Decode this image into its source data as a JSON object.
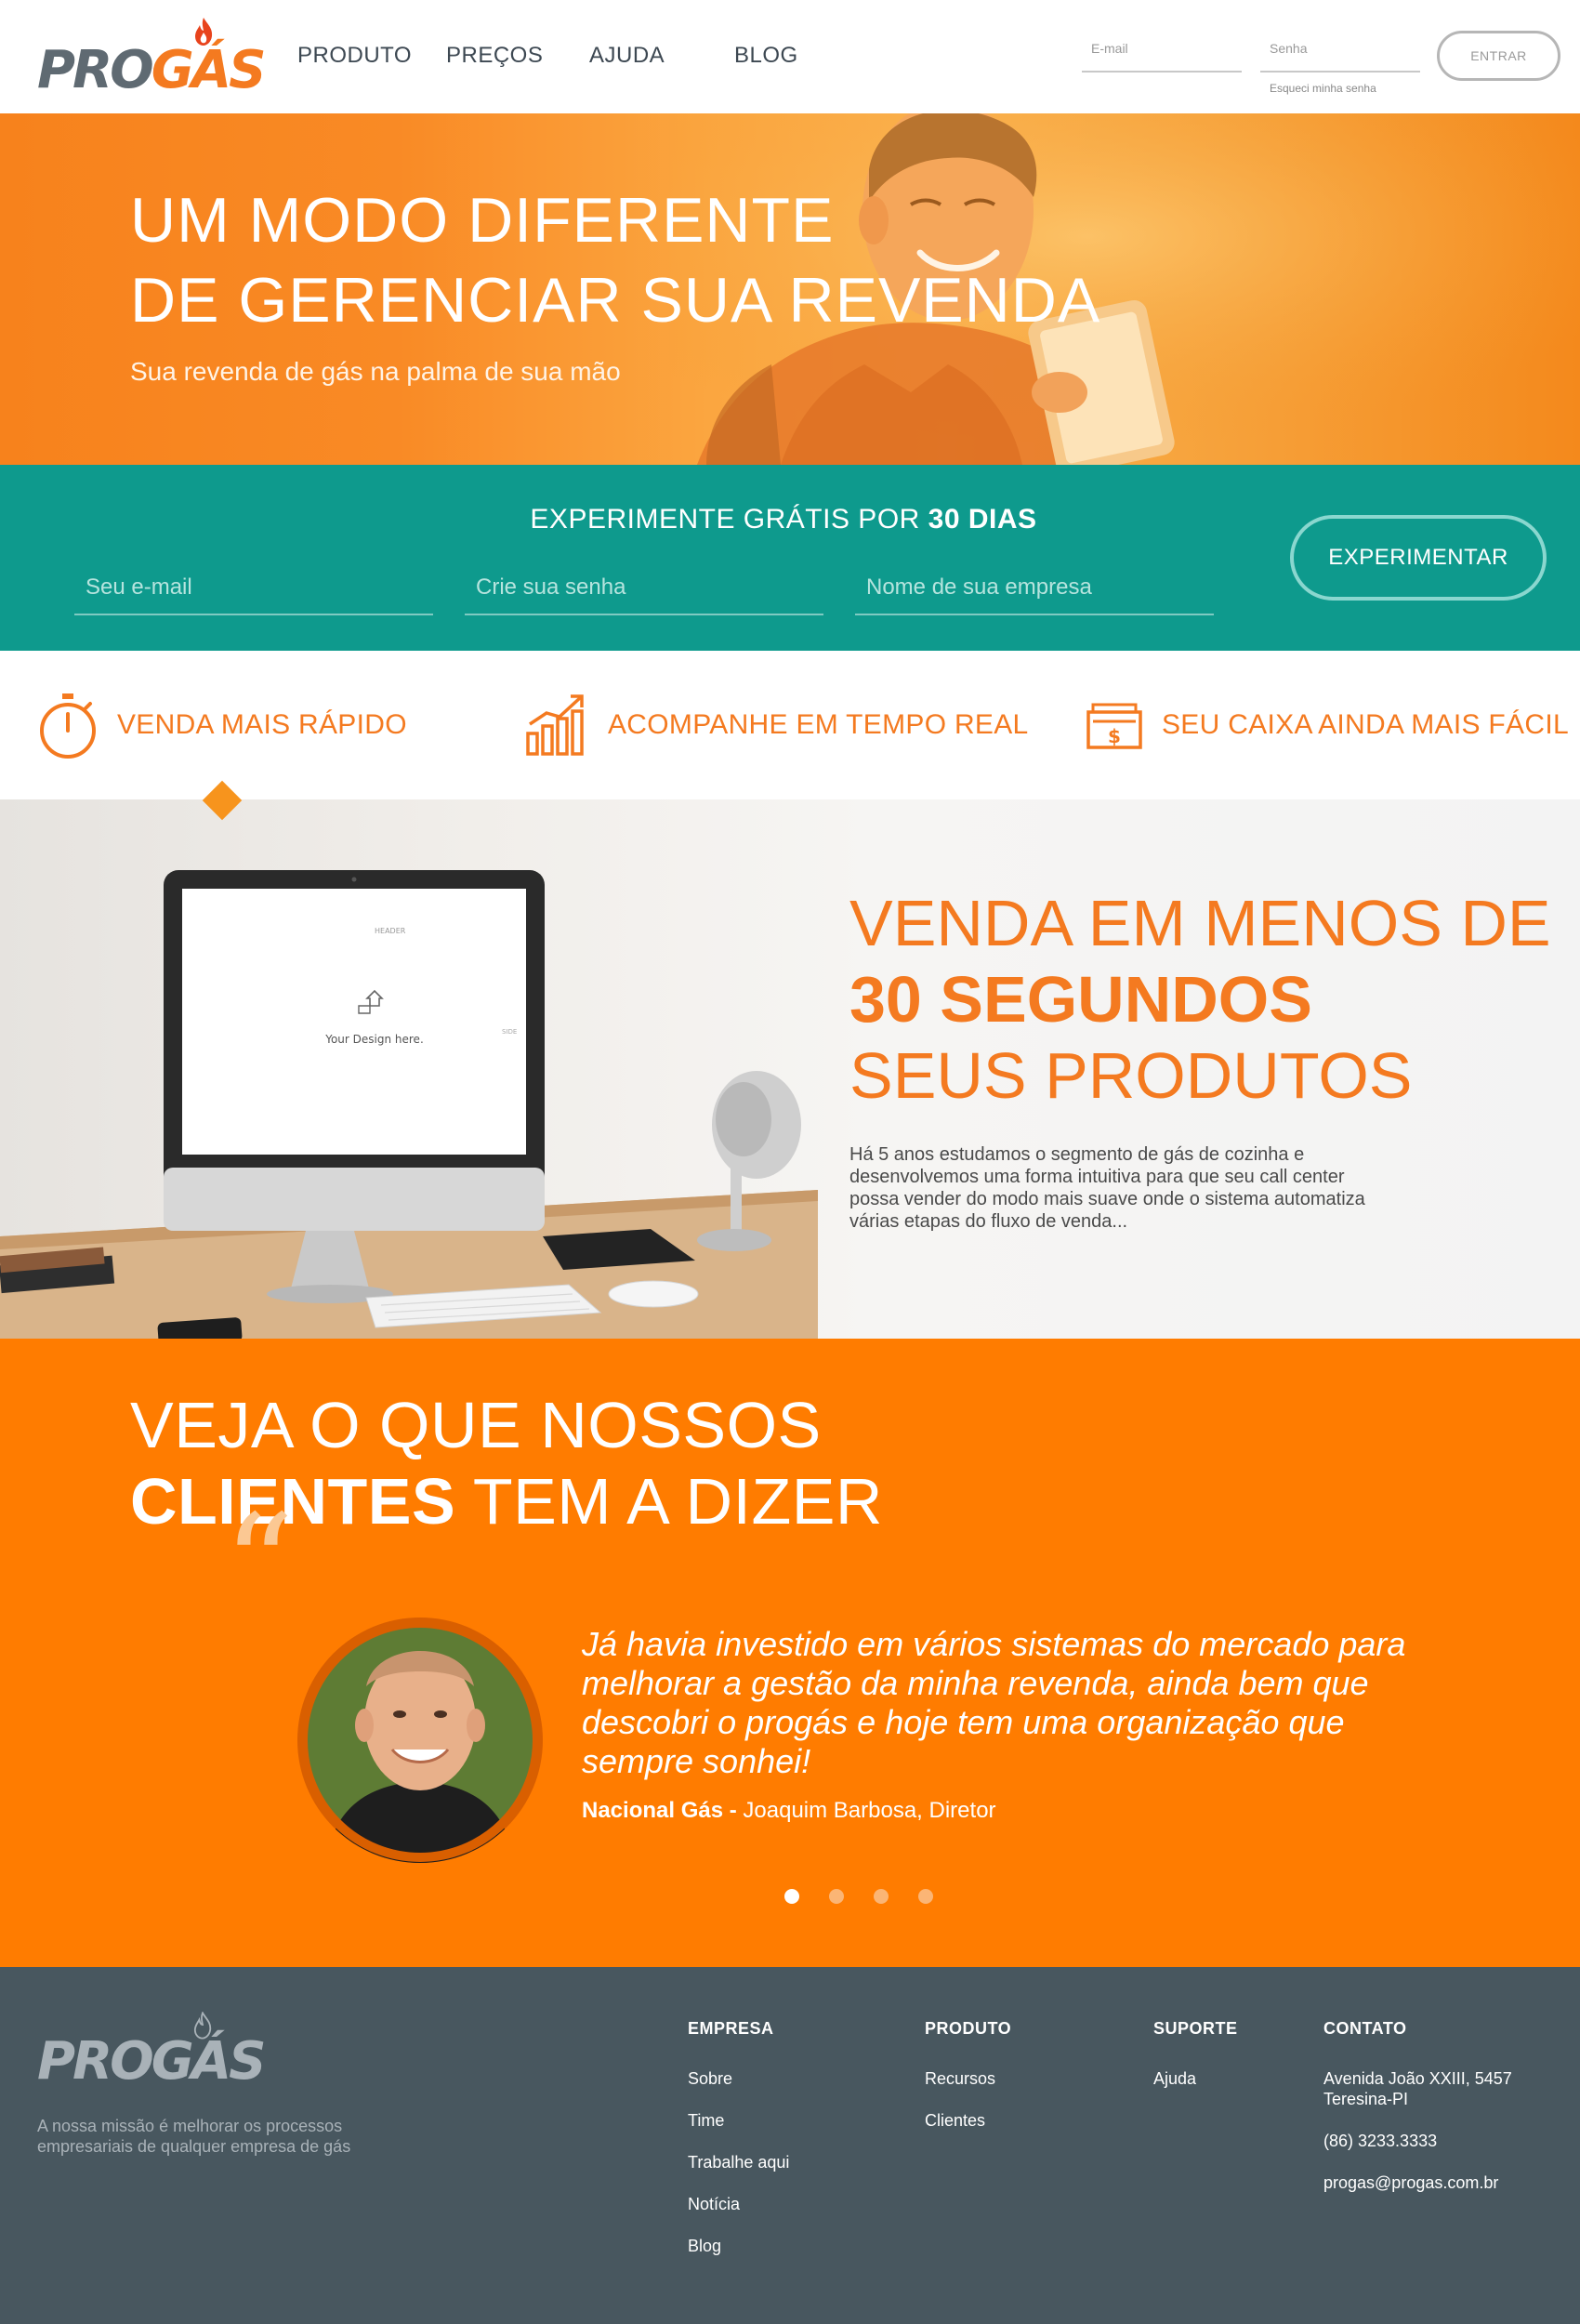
{
  "brand": {
    "pro": "PRO",
    "gas": "GÁS",
    "accent": "#f47a20",
    "teal": "#0e9a8d",
    "dark": "#48575f"
  },
  "nav": {
    "items": [
      "PRODUTO",
      "PREÇOS",
      "AJUDA",
      "BLOG"
    ]
  },
  "login": {
    "email_placeholder": "E-mail",
    "password_placeholder": "Senha",
    "forgot": "Esqueci minha senha",
    "submit": "ENTRAR"
  },
  "hero": {
    "title_line1": "UM MODO DIFERENTE",
    "title_line2": "DE GERENCIAR SUA REVENDA",
    "subtitle": "Sua revenda de gás na palma de sua mão"
  },
  "signup": {
    "title_prefix": "EXPERIMENTE GRÁTIS POR",
    "title_bold": "30 DIAS",
    "fields": [
      "Seu e-mail",
      "Crie sua senha",
      "Nome de sua empresa"
    ],
    "button": "EXPERIMENTAR"
  },
  "features": [
    {
      "label": "VENDA MAIS RÁPIDO",
      "icon": "stopwatch-icon"
    },
    {
      "label": "ACOMPANHE EM TEMPO REAL",
      "icon": "growth-chart-icon"
    },
    {
      "label": "SEU CAIXA AINDA MAIS FÁCIL",
      "icon": "cash-register-icon"
    }
  ],
  "product": {
    "headline_line1": "VENDA EM MENOS DE",
    "headline_bold": "30 SEGUNDOS",
    "headline_line3": "SEUS PRODUTOS",
    "screen_text": "Your Design here.",
    "description": "Há 5 anos estudamos o segmento de gás de cozinha e desenvolvemos uma forma intuitiva para que seu call center possa vender do modo mais suave onde o sistema automatiza várias etapas do fluxo de venda..."
  },
  "testimonials": {
    "heading_line1": "VEJA O QUE NOSSOS",
    "heading_bold": "CLIENTES",
    "heading_rest": "TEM A DIZER",
    "quote": "Já havia investido em vários sistemas do mercado para melhorar a gestão da minha revenda, ainda bem que descobri o progás e hoje tem uma organização que sempre sonhei!",
    "company": "Nacional Gás -",
    "author": "Joaquim Barbosa, Diretor",
    "slide_count": 4,
    "active_slide": 1
  },
  "footer": {
    "mission": "A nossa missão é melhorar os processos empresariais de qualquer empresa de gás",
    "columns": [
      {
        "title": "EMPRESA",
        "items": [
          "Sobre",
          "Time",
          "Trabalhe aqui",
          "Notícia",
          "Blog"
        ]
      },
      {
        "title": "PRODUTO",
        "items": [
          "Recursos",
          "Clientes"
        ]
      },
      {
        "title": "SUPORTE",
        "items": [
          "Ajuda"
        ]
      },
      {
        "title": "CONTATO",
        "items": [
          "Avenida João XXIII, 5457 Teresina-PI",
          "(86) 3233.3333",
          "progas@progas.com.br"
        ]
      }
    ]
  }
}
